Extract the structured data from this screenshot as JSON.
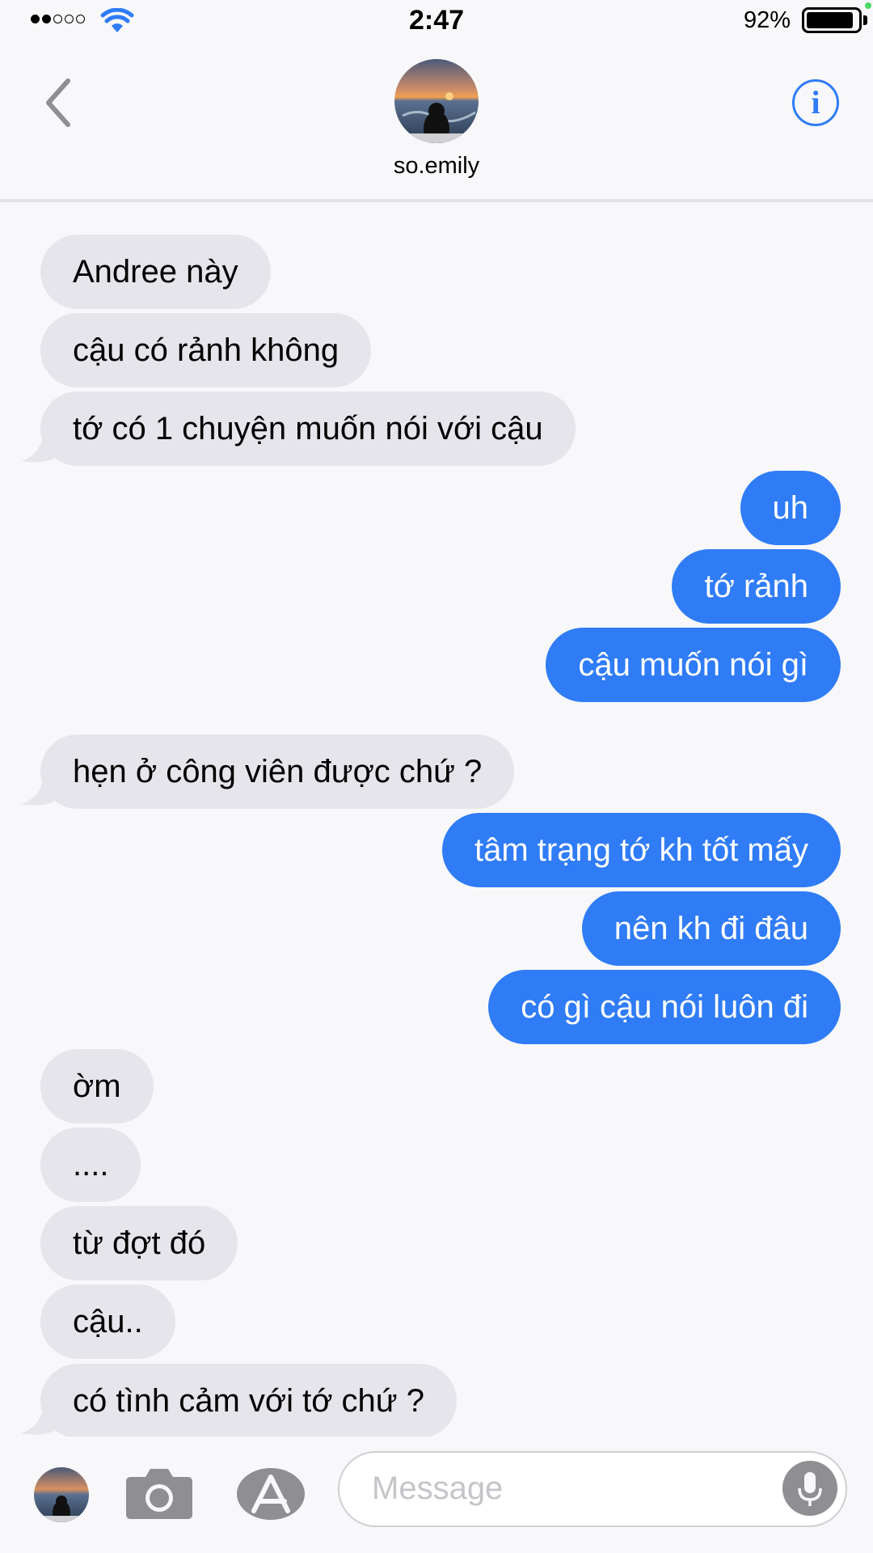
{
  "status_bar": {
    "time": "2:47",
    "battery_percent": "92%",
    "signal_bars_filled": 2,
    "signal_bars_total": 5
  },
  "header": {
    "contact_name": "so.emily",
    "info_label": "i"
  },
  "colors": {
    "outgoing_bubble": "#2f7cf6",
    "incoming_bubble": "#e6e5eb",
    "accent": "#2f7cf6"
  },
  "messages": [
    {
      "direction": "incoming",
      "text": "Andree này"
    },
    {
      "direction": "incoming",
      "text": "cậu có rảnh không"
    },
    {
      "direction": "incoming",
      "text": "tớ có 1 chuyện muốn nói với cậu"
    },
    {
      "direction": "outgoing",
      "text": "uh"
    },
    {
      "direction": "outgoing",
      "text": "tớ rảnh"
    },
    {
      "direction": "outgoing",
      "text": "cậu muốn nói gì"
    },
    {
      "direction": "incoming",
      "text": "hẹn ở công viên được chứ ?"
    },
    {
      "direction": "outgoing",
      "text": "tâm trạng tớ kh tốt mấy"
    },
    {
      "direction": "outgoing",
      "text": "nên kh đi đâu"
    },
    {
      "direction": "outgoing",
      "text": "có gì cậu nói luôn đi"
    },
    {
      "direction": "incoming",
      "text": "ờm"
    },
    {
      "direction": "incoming",
      "text": "...."
    },
    {
      "direction": "incoming",
      "text": "từ đợt đó"
    },
    {
      "direction": "incoming",
      "text": "cậu.."
    },
    {
      "direction": "incoming",
      "text": "có tình cảm với tớ chứ ?"
    }
  ],
  "composer": {
    "placeholder": "Message"
  },
  "icons": {
    "back": "chevron-left-icon",
    "info": "info-icon",
    "camera": "camera-icon",
    "app_store": "app-store-icon",
    "mic": "microphone-icon",
    "wifi": "wifi-icon"
  }
}
